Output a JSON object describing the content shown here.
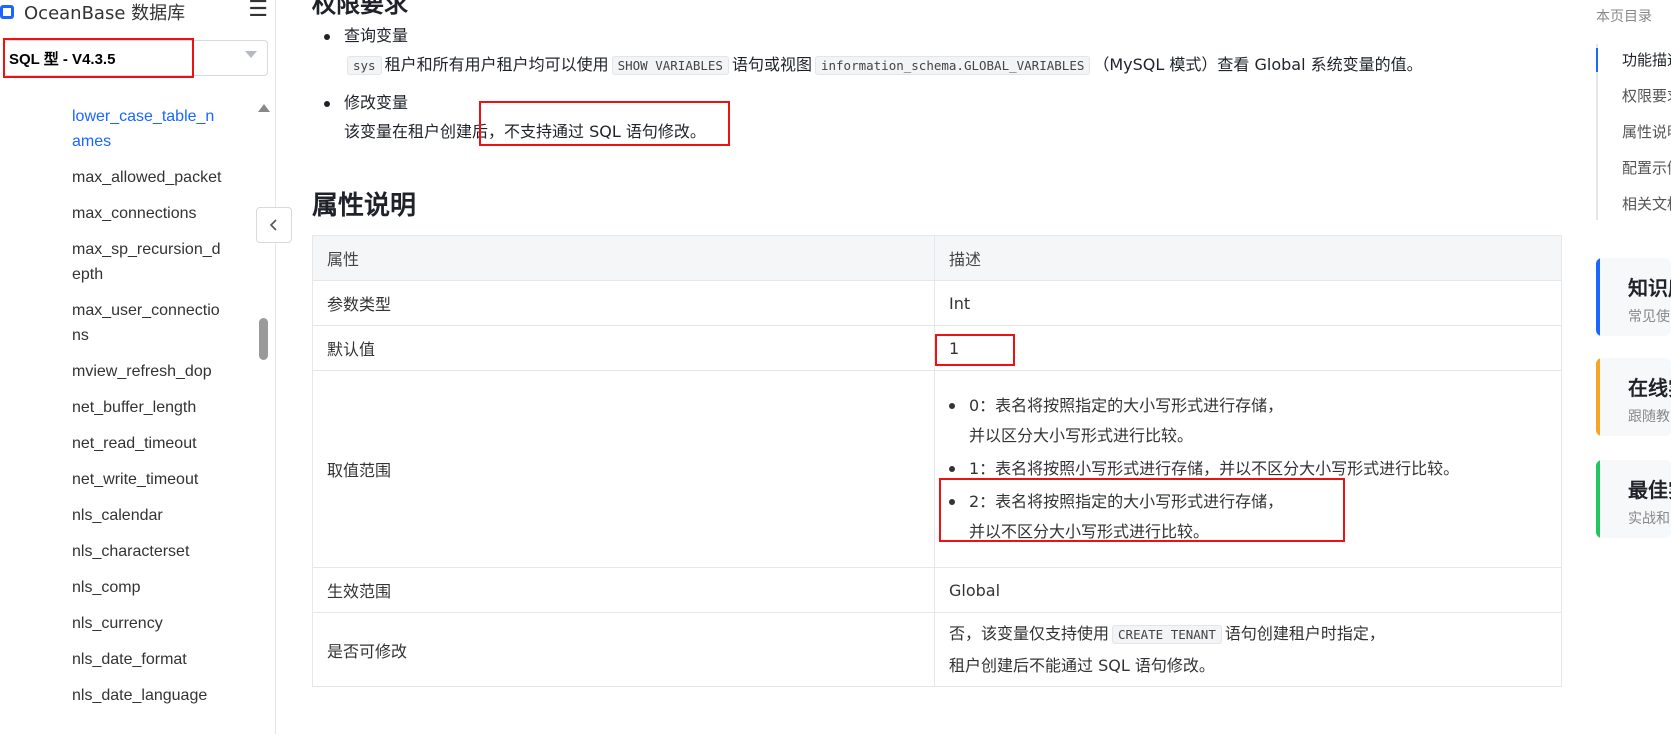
{
  "brand": {
    "title": "OceanBase 数据库",
    "menu_icon": "hamburger-icon"
  },
  "version_select": {
    "value": "SQL 型 - V4.3.5"
  },
  "sidebar": {
    "items": [
      {
        "label": "lower_case_table_names",
        "active": true
      },
      {
        "label": "max_allowed_packet"
      },
      {
        "label": "max_connections"
      },
      {
        "label": "max_sp_recursion_depth"
      },
      {
        "label": "max_user_connections"
      },
      {
        "label": "mview_refresh_dop"
      },
      {
        "label": "net_buffer_length"
      },
      {
        "label": "net_read_timeout"
      },
      {
        "label": "net_write_timeout"
      },
      {
        "label": "nls_calendar"
      },
      {
        "label": "nls_characterset"
      },
      {
        "label": "nls_comp"
      },
      {
        "label": "nls_currency"
      },
      {
        "label": "nls_date_format"
      },
      {
        "label": "nls_date_language"
      }
    ]
  },
  "content": {
    "cut_heading": "权限要求",
    "query": {
      "title": "查询变量",
      "code1": "sys",
      "text1": "租户和所有用户租户均可以使用",
      "code2": "SHOW VARIABLES",
      "text2": "语句或视图",
      "code3": "information_schema.GLOBAL_VARIABLES",
      "text3": "（MySQL 模式）查看 Global 系统变量的值。"
    },
    "modify": {
      "title": "修改变量",
      "text_a": "该变量在租户创建后，",
      "text_b": "不支持通过 SQL 语句修改。"
    },
    "section_title": "属性说明",
    "table": {
      "header_attr": "属性",
      "header_desc": "描述",
      "rows": {
        "type_label": "参数类型",
        "type_value": "Int",
        "default_label": "默认值",
        "default_value": "1",
        "range_label": "取值范围",
        "range_0_line1": "0：表名将按照指定的大小写形式进行存储，",
        "range_0_line2": "并以区分大小写形式进行比较。",
        "range_1": "1：表名将按照小写形式进行存储，并以不区分大小写形式进行比较。",
        "range_2_line1": "2：表名将按照指定的大小写形式进行存储，",
        "range_2_line2": "并以不区分大小写形式进行比较。",
        "scope_label": "生效范围",
        "scope_value": "Global",
        "modifiable_label": "是否可修改",
        "modifiable_a": "否，该变量仅支持使用",
        "modifiable_code": "CREATE TENANT",
        "modifiable_b": "语句创建租户时指定，",
        "modifiable_c": "租户创建后不能通过 SQL 语句修改。"
      }
    }
  },
  "toc": {
    "title": "本页目录",
    "items": [
      "功能描述",
      "权限要求",
      "属性说明",
      "配置示例",
      "相关文档"
    ]
  },
  "cards": [
    {
      "title": "知识库",
      "sub": "常见使",
      "color": "#1a66ff"
    },
    {
      "title": "在线实",
      "sub": "跟随教",
      "color": "#f5a623"
    },
    {
      "title": "最佳实",
      "sub": "实战和",
      "color": "#22c55e"
    }
  ],
  "colors": {
    "accent": "#1a66ff",
    "highlight": "#e11111"
  }
}
